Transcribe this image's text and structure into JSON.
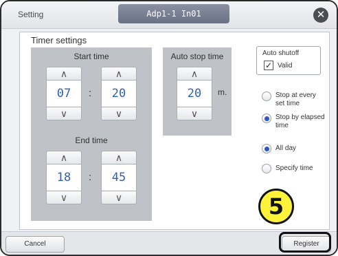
{
  "titlebar": {
    "left_label": "Setting",
    "unit_name": "Adp1-1 In01",
    "close_icon": "✕"
  },
  "timer": {
    "title": "Timer settings",
    "start": {
      "label": "Start time",
      "hour": "07",
      "minute": "20",
      "separator": ":"
    },
    "end": {
      "label": "End time",
      "hour": "18",
      "minute": "45",
      "separator": ":"
    },
    "auto_stop": {
      "label": "Auto stop time",
      "value": "20",
      "unit": "m."
    },
    "arrow_up": "∧",
    "arrow_down": "∨"
  },
  "auto_shutoff": {
    "title": "Auto shutoff",
    "check_label": "Valid",
    "checked": true,
    "check_mark": "✓"
  },
  "stop_mode": {
    "options": [
      {
        "label": "Stop at every set time",
        "selected": false
      },
      {
        "label": "Stop by elapsed time",
        "selected": true
      }
    ]
  },
  "day_mode": {
    "options": [
      {
        "label": "All day",
        "selected": true
      },
      {
        "label": "Specify time",
        "selected": false
      }
    ]
  },
  "footer": {
    "cancel_label": "Cancel",
    "register_label": "Register"
  },
  "annotation": {
    "step_number": "5"
  }
}
